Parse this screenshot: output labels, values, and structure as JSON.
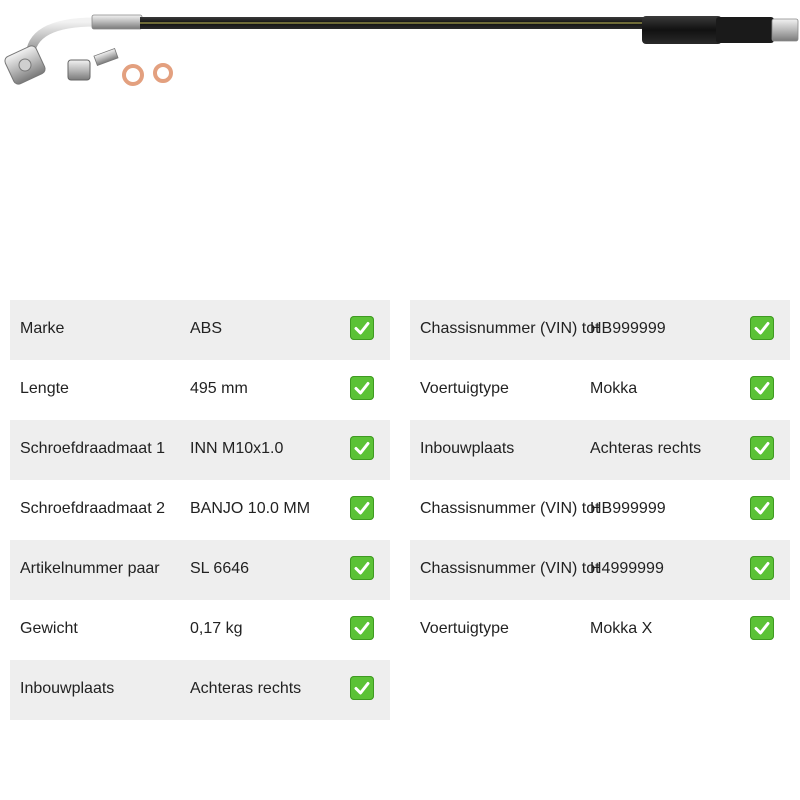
{
  "left_table": [
    {
      "label": "Marke",
      "value": "ABS"
    },
    {
      "label": "Lengte",
      "value": "495 mm"
    },
    {
      "label": "Schroefdraadmaat 1",
      "value": "INN M10x1.0"
    },
    {
      "label": "Schroefdraadmaat 2",
      "value": "BANJO 10.0 MM"
    },
    {
      "label": "Artikelnummer paar",
      "value": "SL 6646"
    },
    {
      "label": "Gewicht",
      "value": "0,17 kg"
    },
    {
      "label": "Inbouwplaats",
      "value": "Achteras rechts"
    }
  ],
  "right_table": [
    {
      "label": "Chassisnummer (VIN) tot",
      "value": "HB999999"
    },
    {
      "label": "Voertuigtype",
      "value": "Mokka"
    },
    {
      "label": "Inbouwplaats",
      "value": "Achteras rechts"
    },
    {
      "label": "Chassisnummer (VIN) tot",
      "value": "HB999999"
    },
    {
      "label": "Chassisnummer (VIN) tot",
      "value": "H4999999"
    },
    {
      "label": "Voertuigtype",
      "value": "Mokka X"
    }
  ],
  "icons": {
    "status": "check-mark-icon"
  },
  "colors": {
    "check": "#5bc236",
    "row_shade": "#eeeeee"
  }
}
